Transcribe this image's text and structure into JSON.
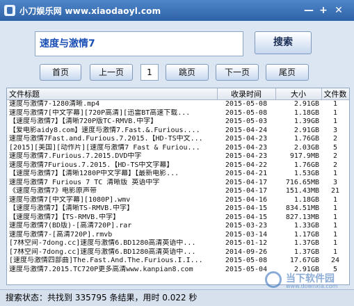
{
  "window": {
    "title": "小刀娱乐网 www.xiaodaoyl.com",
    "min_glyph": "—",
    "max_glyph": "+",
    "close_glyph": "✕"
  },
  "search": {
    "query": "速度与激情7",
    "button_label": "搜索"
  },
  "pager": {
    "first_label": "首页",
    "prev_label": "上一页",
    "page_number": "1",
    "jump_label": "跳页",
    "next_label": "下一页",
    "last_label": "尾页"
  },
  "table": {
    "columns": [
      "文件标题",
      "收录时间",
      "大小",
      "文件数"
    ],
    "rows": [
      {
        "title": "速度与激情7-1280清晰.mp4",
        "date": "2015-05-08",
        "size": "2.91GB",
        "count": "1"
      },
      {
        "title": "速度与激情7[中文字幕][720P高清][迅雷BT高速下载...",
        "date": "2015-05-08",
        "size": "1.18GB",
        "count": "1"
      },
      {
        "title": "【速度与激情7】【清晰720P版TC-RMVB.中字】",
        "date": "2015-05-03",
        "size": "1.39GB",
        "count": "1"
      },
      {
        "title": "【爱电影aidy8.com】速度与激情7.Fast.&.Furious....",
        "date": "2015-04-24",
        "size": "2.91GB",
        "count": "3"
      },
      {
        "title": "速度与激情7Fast.and.Furious.7.2015.【HD-TS中文...",
        "date": "2015-04-23",
        "size": "1.76GB",
        "count": "2"
      },
      {
        "title": "[2015][美国][动作片][速度与激情7 Fast & Furiou...",
        "date": "2015-04-23",
        "size": "2.03GB",
        "count": "5"
      },
      {
        "title": "速度与激情7.Furious.7.2015.DVD中字",
        "date": "2015-04-23",
        "size": "917.9MB",
        "count": "2"
      },
      {
        "title": "速度与激情7Furious.7.2015.【HD-TS中文字幕】",
        "date": "2015-04-22",
        "size": "1.76GB",
        "count": "2"
      },
      {
        "title": "【速度与激情7】【清晰1280P中文字幕】【最新电影...",
        "date": "2015-04-21",
        "size": "1.53GB",
        "count": "1"
      },
      {
        "title": "速度与激情7 Furious 7 TC 清晰版 英语中字",
        "date": "2015-04-17",
        "size": "716.65MB",
        "count": "3"
      },
      {
        "title": "《速度与激情7》电影原声带",
        "date": "2015-04-17",
        "size": "151.43MB",
        "count": "21"
      },
      {
        "title": "速度与激情7[中文字幕][1080P].wmv",
        "date": "2015-04-16",
        "size": "1.18GB",
        "count": "1"
      },
      {
        "title": "【速度与激情7】【清晰TS-RMVB.中字】",
        "date": "2015-04-15",
        "size": "834.51MB",
        "count": "1"
      },
      {
        "title": "【速度与激情7】【TS-RMVB.中字】",
        "date": "2015-04-15",
        "size": "827.13MB",
        "count": "1"
      },
      {
        "title": "速度与激情7(BD版)-[高清720P].rar",
        "date": "2015-03-23",
        "size": "1.33GB",
        "count": "1"
      },
      {
        "title": "速度与激情7-[高清720P].rmvb",
        "date": "2015-03-14",
        "size": "1.17GB",
        "count": "1"
      },
      {
        "title": "[7林空间-7dong.cc]速度与激情6.BD1280高清英语中...",
        "date": "2015-01-12",
        "size": "1.37GB",
        "count": "1"
      },
      {
        "title": "[7林空间-7dong.cc]速度与激情6.BD1280高清英语中...",
        "date": "2014-09-26",
        "size": "1.37GB",
        "count": "1"
      },
      {
        "title": "[速度与激情四部曲]The.Fast.And.The.Furious.I.I...",
        "date": "2015-05-08",
        "size": "17.67GB",
        "count": "24"
      },
      {
        "title": "速度与激情7.2015.TC720P更多高清www.kanpian8.com",
        "date": "2015-05-04",
        "size": "2.91GB",
        "count": "5"
      }
    ]
  },
  "status": {
    "text": "搜索状态：共找到 335795 条结果，用时 0.022 秒"
  },
  "watermark": {
    "name": "当下软件园",
    "url": "www.downxia.com"
  }
}
